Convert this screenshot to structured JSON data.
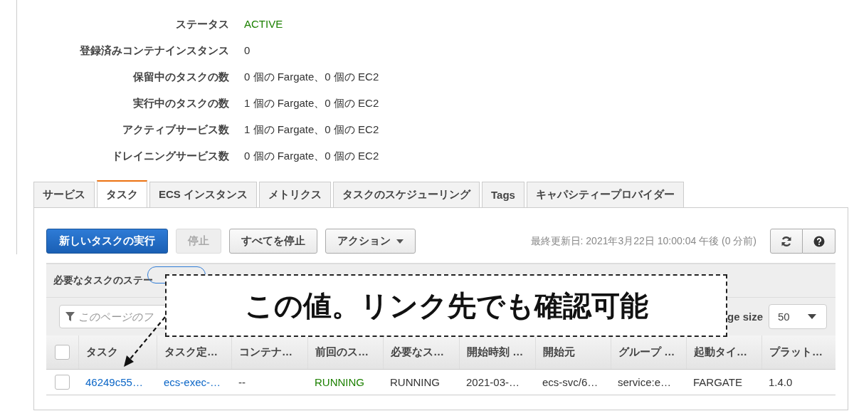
{
  "summary": [
    {
      "label": "ステータス",
      "value": "ACTIVE",
      "kind": "status"
    },
    {
      "label": "登録済みコンテナインスタンス",
      "value": "0",
      "kind": "text"
    },
    {
      "label": "保留中のタスクの数",
      "value": "0 個の Fargate、0 個の EC2",
      "kind": "text"
    },
    {
      "label": "実行中のタスクの数",
      "value": "1 個の Fargate、0 個の EC2",
      "kind": "text"
    },
    {
      "label": "アクティブサービス数",
      "value": "1 個の Fargate、0 個の EC2",
      "kind": "text"
    },
    {
      "label": "ドレイニングサービス数",
      "value": "0 個の Fargate、0 個の EC2",
      "kind": "text"
    }
  ],
  "tabs": [
    {
      "label": "サービス",
      "selected": false
    },
    {
      "label": "タスク",
      "selected": true
    },
    {
      "label": "ECS インスタンス",
      "selected": false
    },
    {
      "label": "メトリクス",
      "selected": false
    },
    {
      "label": "タスクのスケジューリング",
      "selected": false
    },
    {
      "label": "Tags",
      "selected": false
    },
    {
      "label": "キャパシティープロバイダー",
      "selected": false
    }
  ],
  "toolbar": {
    "buttons": [
      {
        "label": "新しいタスクの実行",
        "kind": "primary",
        "disabled": false
      },
      {
        "label": "停止",
        "kind": "default",
        "disabled": true
      },
      {
        "label": "すべてを停止",
        "kind": "default",
        "disabled": false
      },
      {
        "label": "アクション",
        "kind": "dropdown",
        "disabled": false
      }
    ],
    "last_updated": "最終更新日: 2021年3月22日 10:00:04 午後 (0 分前)"
  },
  "filter": {
    "status_label": "必要なタスクのステー",
    "search": {
      "placeholder": "このページのフ"
    },
    "page_size_label": "ge size",
    "page_size": "50"
  },
  "table": {
    "columns": [
      "タスク",
      "タスク定…",
      "コンテナ…",
      "前回のス…",
      "必要なス…",
      "開始時刻 …",
      "開始元",
      "グループ …",
      "起動タイ…",
      "プラット…"
    ],
    "header_checked": false,
    "rows": [
      {
        "selected": false,
        "cells": [
          {
            "text": "46249c55…",
            "kind": "link"
          },
          {
            "text": "ecs-exec-…",
            "kind": "link"
          },
          {
            "text": "--",
            "kind": "text"
          },
          {
            "text": "RUNNING",
            "kind": "status"
          },
          {
            "text": "RUNNING",
            "kind": "text"
          },
          {
            "text": "2021-03-…",
            "kind": "text"
          },
          {
            "text": "ecs-svc/6…",
            "kind": "text"
          },
          {
            "text": "service:e…",
            "kind": "text"
          },
          {
            "text": "FARGATE",
            "kind": "text"
          },
          {
            "text": "1.4.0",
            "kind": "text"
          }
        ]
      }
    ]
  },
  "callout": {
    "text": "この値。リンク先でも確認可能"
  }
}
